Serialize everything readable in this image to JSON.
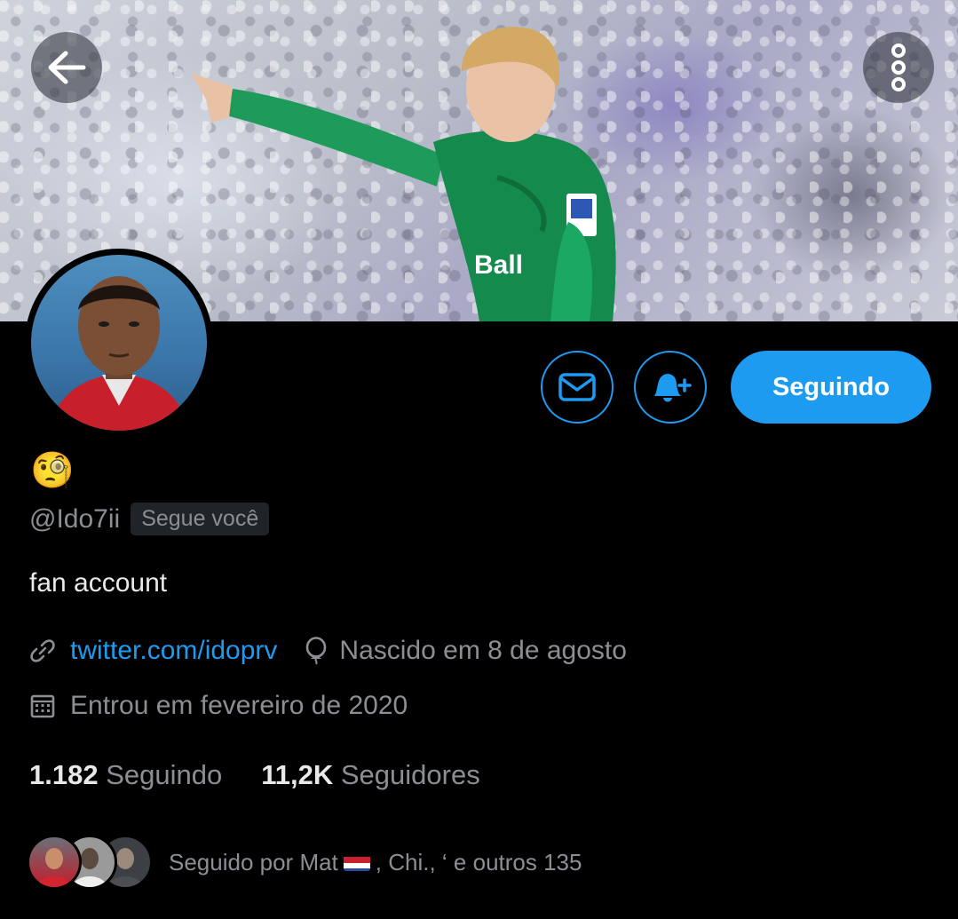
{
  "profile": {
    "display_name_emoji": "🧐",
    "handle": "@Ido7ii",
    "follows_you": "Segue você",
    "bio": "fan account",
    "website": "twitter.com/idoprv",
    "birthday": "Nascido em 8 de agosto",
    "joined": "Entrou em fevereiro de 2020"
  },
  "actions": {
    "follow_label": "Seguindo"
  },
  "stats": {
    "following_count": "1.182",
    "following_label": "Seguindo",
    "followers_count": "11,2K",
    "followers_label": "Seguidores"
  },
  "followed_by": {
    "prefix": "Seguido por Mat",
    "suffix": ", Chi., ‘ e outros 135"
  },
  "icons": {
    "back": "arrow-left-icon",
    "more": "more-vertical-icon",
    "message": "envelope-icon",
    "notify": "bell-plus-icon",
    "link": "link-icon",
    "birthday": "balloon-icon",
    "calendar": "calendar-icon",
    "flag": "netherlands-flag-icon"
  },
  "colors": {
    "accent": "#1d9bf0",
    "background": "#000000",
    "secondary_text": "#8b8f94",
    "primary_text": "#e7e9ea"
  }
}
